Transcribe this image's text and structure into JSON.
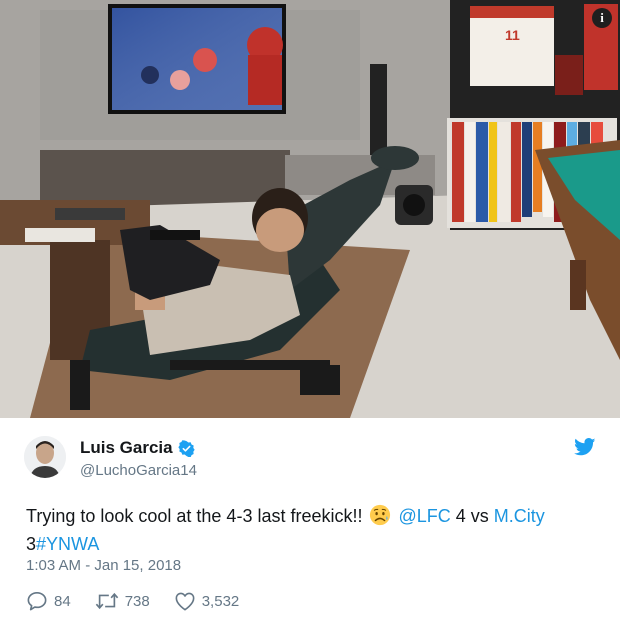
{
  "photo": {
    "alt_icon": "info-icon",
    "info_label": "i",
    "jersey_number": "11"
  },
  "tweet": {
    "display_name": "Luis Garcia",
    "verified_icon": "verified-badge-icon",
    "handle": "@LuchoGarcia14",
    "text": {
      "part1": "Trying to look cool at the 4-3 last freekick!! ",
      "emoji_icon": "worried-face-emoji",
      "mention_lfc": "@LFC",
      "part2": " 4 vs ",
      "mention_city": "M.City",
      "part3": " 3",
      "hashtag": "#YNWA"
    },
    "timestamp": "1:03 AM - Jan 15, 2018",
    "actions": {
      "reply_count": "84",
      "retweet_count": "738",
      "like_count": "3,532"
    },
    "brand_icon": "twitter-bird-icon"
  },
  "colors": {
    "link": "#1b95e0",
    "secondary_text": "#657786",
    "twitter_blue": "#1da1f2"
  }
}
